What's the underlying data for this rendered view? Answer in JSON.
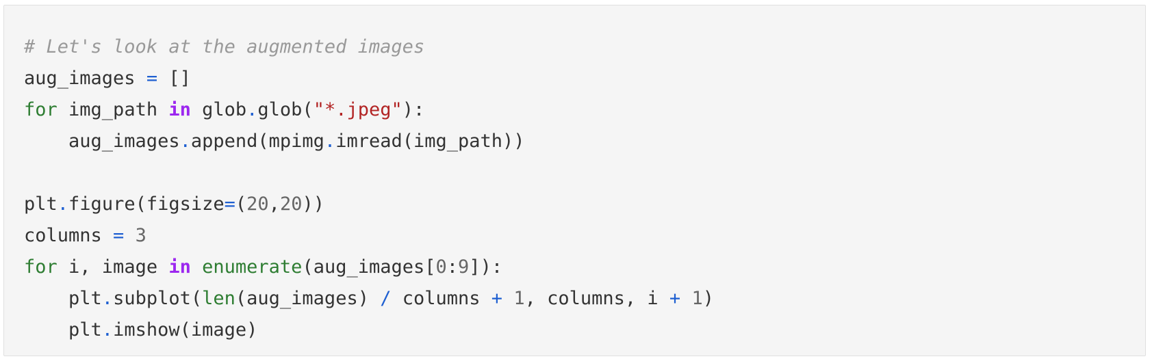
{
  "code": {
    "lines": [
      [
        {
          "t": "# Let's look at the augmented images",
          "c": "c"
        }
      ],
      [
        {
          "t": "aug_images "
        },
        {
          "t": "=",
          "c": "o"
        },
        {
          "t": " []"
        }
      ],
      [
        {
          "t": "for",
          "c": "k"
        },
        {
          "t": " img_path "
        },
        {
          "t": "in",
          "c": "kw"
        },
        {
          "t": " glob"
        },
        {
          "t": ".",
          "c": "o"
        },
        {
          "t": "glob("
        },
        {
          "t": "\"*.jpeg\"",
          "c": "s"
        },
        {
          "t": "):"
        }
      ],
      [
        {
          "t": "    aug_images"
        },
        {
          "t": ".",
          "c": "o"
        },
        {
          "t": "append(mpimg"
        },
        {
          "t": ".",
          "c": "o"
        },
        {
          "t": "imread(img_path))"
        }
      ],
      [],
      [
        {
          "t": "plt"
        },
        {
          "t": ".",
          "c": "o"
        },
        {
          "t": "figure(figsize"
        },
        {
          "t": "=",
          "c": "o"
        },
        {
          "t": "("
        },
        {
          "t": "20",
          "c": "n"
        },
        {
          "t": ","
        },
        {
          "t": "20",
          "c": "n"
        },
        {
          "t": "))"
        }
      ],
      [
        {
          "t": "columns "
        },
        {
          "t": "=",
          "c": "o"
        },
        {
          "t": " "
        },
        {
          "t": "3",
          "c": "n"
        }
      ],
      [
        {
          "t": "for",
          "c": "k"
        },
        {
          "t": " i, image "
        },
        {
          "t": "in",
          "c": "kw"
        },
        {
          "t": " "
        },
        {
          "t": "enumerate",
          "c": "b"
        },
        {
          "t": "(aug_images["
        },
        {
          "t": "0",
          "c": "n"
        },
        {
          "t": ":"
        },
        {
          "t": "9",
          "c": "n"
        },
        {
          "t": "]):"
        }
      ],
      [
        {
          "t": "    plt"
        },
        {
          "t": ".",
          "c": "o"
        },
        {
          "t": "subplot("
        },
        {
          "t": "len",
          "c": "b"
        },
        {
          "t": "(aug_images) "
        },
        {
          "t": "/",
          "c": "o"
        },
        {
          "t": " columns "
        },
        {
          "t": "+",
          "c": "o"
        },
        {
          "t": " "
        },
        {
          "t": "1",
          "c": "n"
        },
        {
          "t": ", columns, i "
        },
        {
          "t": "+",
          "c": "o"
        },
        {
          "t": " "
        },
        {
          "t": "1",
          "c": "n"
        },
        {
          "t": ")"
        }
      ],
      [
        {
          "t": "    plt"
        },
        {
          "t": ".",
          "c": "o"
        },
        {
          "t": "imshow(image)"
        }
      ]
    ]
  },
  "colors": {
    "background": "#f5f5f5",
    "text": "#333333",
    "comment": "#999999",
    "keyword_for": "#2e7d32",
    "keyword_in": "#9c27ef",
    "operator": "#1e5fd1",
    "string": "#b22424",
    "number": "#666666",
    "builtin": "#2e7d32"
  }
}
